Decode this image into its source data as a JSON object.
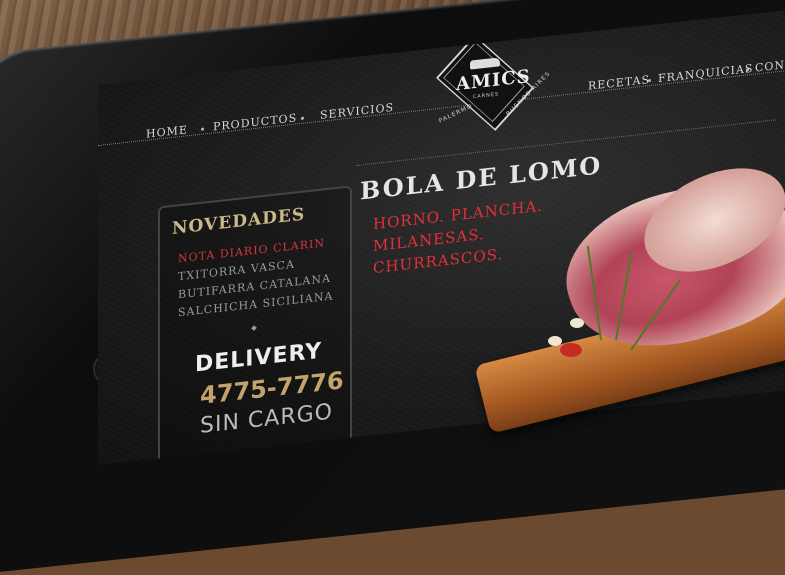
{
  "logo": {
    "name": "AMICS",
    "sub": "CARNES",
    "left_text": "PALERMO",
    "right_text": "BUENOS AIRES"
  },
  "nav": {
    "left": [
      "HOME",
      "PRODUCTOS",
      "SERVICIOS"
    ],
    "right": [
      "RECETAS",
      "FRANQUICIAS",
      "CONT"
    ]
  },
  "sidebar": {
    "title": "NOVEDADES",
    "items": [
      "NOTA DIARIO CLARIN",
      "TXITORRA VASCA",
      "BUTIFARRA CATALANA",
      "SALCHICHA SICILIANA"
    ],
    "active_index": 0,
    "delivery_label": "DELIVERY",
    "phone": "4775-7776",
    "cargo": "SIN CARGO"
  },
  "hero": {
    "title": "BOLA DE LOMO",
    "lines": [
      "HORNO. PLANCHA.",
      "MILANESAS.",
      "CHURRASCOS."
    ]
  },
  "colors": {
    "accent_red": "#d6363f",
    "accent_gold": "#c2a46a",
    "text_light": "#e5e5e5"
  }
}
